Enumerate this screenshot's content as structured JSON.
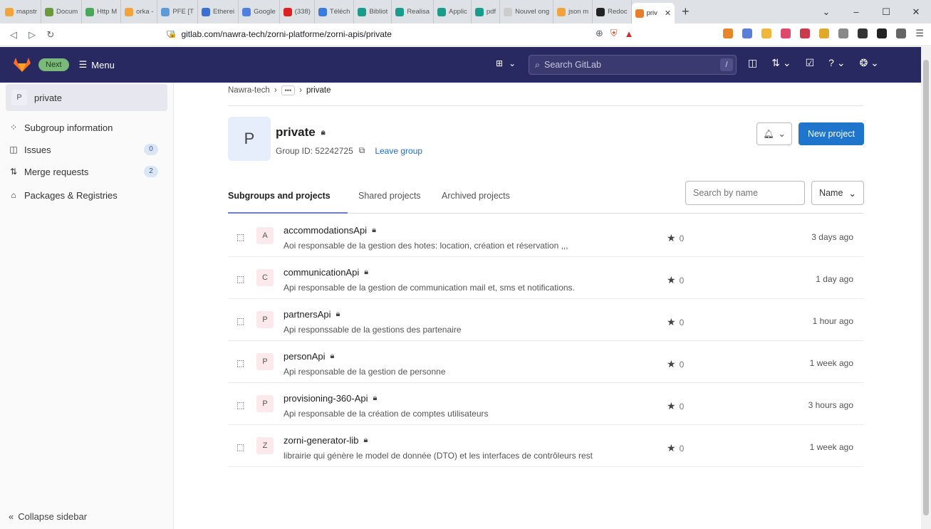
{
  "browser": {
    "tabs": [
      {
        "label": "mapstr",
        "color": "#f2a33a"
      },
      {
        "label": "Docum",
        "color": "#6a9a3c"
      },
      {
        "label": "Http M",
        "color": "#4aa85a"
      },
      {
        "label": "orka -",
        "color": "#f2a33a"
      },
      {
        "label": "PFE [T",
        "color": "#5c9bd6"
      },
      {
        "label": "Etherei",
        "color": "#3b6fd4"
      },
      {
        "label": "Google",
        "color": "#4f7fe0"
      },
      {
        "label": "(338)",
        "color": "#e02020"
      },
      {
        "label": "Téléch",
        "color": "#3a7be0"
      },
      {
        "label": "Bibliot",
        "color": "#1a9c8a"
      },
      {
        "label": "Realisa",
        "color": "#1a9c8a"
      },
      {
        "label": "Applic",
        "color": "#1a9c8a"
      },
      {
        "label": "pdf",
        "color": "#1a9c8a"
      },
      {
        "label": "Nouvel ong",
        "color": "#cccccc"
      },
      {
        "label": "json m",
        "color": "#f2a33a"
      },
      {
        "label": "Redoc",
        "color": "#222222"
      }
    ],
    "active_tab": {
      "label": "priv",
      "color": "#e87d2a"
    },
    "url": "gitlab.com/nawra-tech/zorni-platforme/zorni-apis/private"
  },
  "header": {
    "next_label": "Next",
    "menu_label": "Menu",
    "search_placeholder": "Search GitLab",
    "search_shortcut": "/"
  },
  "sidebar": {
    "context_avatar": "P",
    "context_name": "private",
    "items": [
      {
        "label": "Subgroup information",
        "icon": "subgroup-icon",
        "badge": ""
      },
      {
        "label": "Issues",
        "icon": "issues-icon",
        "badge": "0"
      },
      {
        "label": "Merge requests",
        "icon": "merge-request-icon",
        "badge": "2"
      },
      {
        "label": "Packages & Registries",
        "icon": "package-icon",
        "badge": ""
      }
    ],
    "collapse_label": "Collapse sidebar"
  },
  "breadcrumb": {
    "root": "Nawra-tech",
    "more": "•••",
    "current": "private"
  },
  "group": {
    "avatar": "P",
    "title": "private",
    "id_text": "Group ID: 52242725",
    "leave_label": "Leave group",
    "new_project_label": "New project"
  },
  "tabs": {
    "subgroups": "Subgroups and projects",
    "shared": "Shared projects",
    "archived": "Archived projects"
  },
  "filter": {
    "search_placeholder": "Search by name",
    "sort_label": "Name"
  },
  "projects": [
    {
      "avatar": "A",
      "name": "accommodationsApi",
      "description": "Aoi responsable de la gestion des hotes: location, création et réservation ,,,",
      "stars": "0",
      "updated": "3 days ago"
    },
    {
      "avatar": "C",
      "name": "communicationApi",
      "description": "Api responsable de la gestion de communication mail et, sms et notifications.",
      "stars": "0",
      "updated": "1 day ago"
    },
    {
      "avatar": "P",
      "name": "partnersApi",
      "description": "Api responssable de la gestions des partenaire",
      "stars": "0",
      "updated": "1 hour ago"
    },
    {
      "avatar": "P",
      "name": "personApi",
      "description": "Api responsable de la gestion de personne",
      "stars": "0",
      "updated": "1 week ago"
    },
    {
      "avatar": "P",
      "name": "provisioning-360-Api",
      "description": "Api responsable de la création de comptes utilisateurs",
      "stars": "0",
      "updated": "3 hours ago"
    },
    {
      "avatar": "Z",
      "name": "zorni-generator-lib",
      "description": "librairie qui génère le model de donnée (DTO) et les interfaces de contrôleurs rest",
      "stars": "0",
      "updated": "1 week ago"
    }
  ]
}
